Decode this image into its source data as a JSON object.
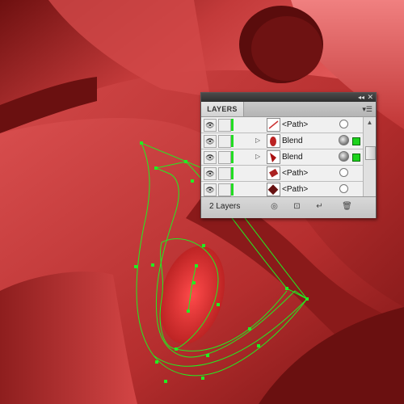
{
  "panel": {
    "title": "LAYERS",
    "collapse_icon": "double-chevron-icon",
    "close_icon": "close-icon",
    "menu_icon": "panel-menu-icon",
    "layers": [
      {
        "name": "<Path>",
        "type": "path",
        "expandable": false,
        "target": "empty",
        "selected": false
      },
      {
        "name": "Blend",
        "type": "blend",
        "expandable": true,
        "target": "appearance",
        "selected": true
      },
      {
        "name": "Blend",
        "type": "blend",
        "expandable": true,
        "target": "appearance",
        "selected": true
      },
      {
        "name": "<Path>",
        "type": "path",
        "expandable": false,
        "target": "empty",
        "selected": false
      },
      {
        "name": "<Path>",
        "type": "path",
        "expandable": false,
        "target": "empty",
        "selected": false
      }
    ],
    "layer_count": "2 Layers",
    "footer_buttons": [
      "locate-object-icon",
      "make-clipping-mask-icon",
      "new-sublayer-icon",
      "new-layer-icon",
      "delete-icon"
    ],
    "colors": {
      "layer_color": "#22dd22",
      "selection": "#1dd31d"
    }
  },
  "artwork": {
    "background": "#b52a2a",
    "path_color": "#22ee22"
  }
}
